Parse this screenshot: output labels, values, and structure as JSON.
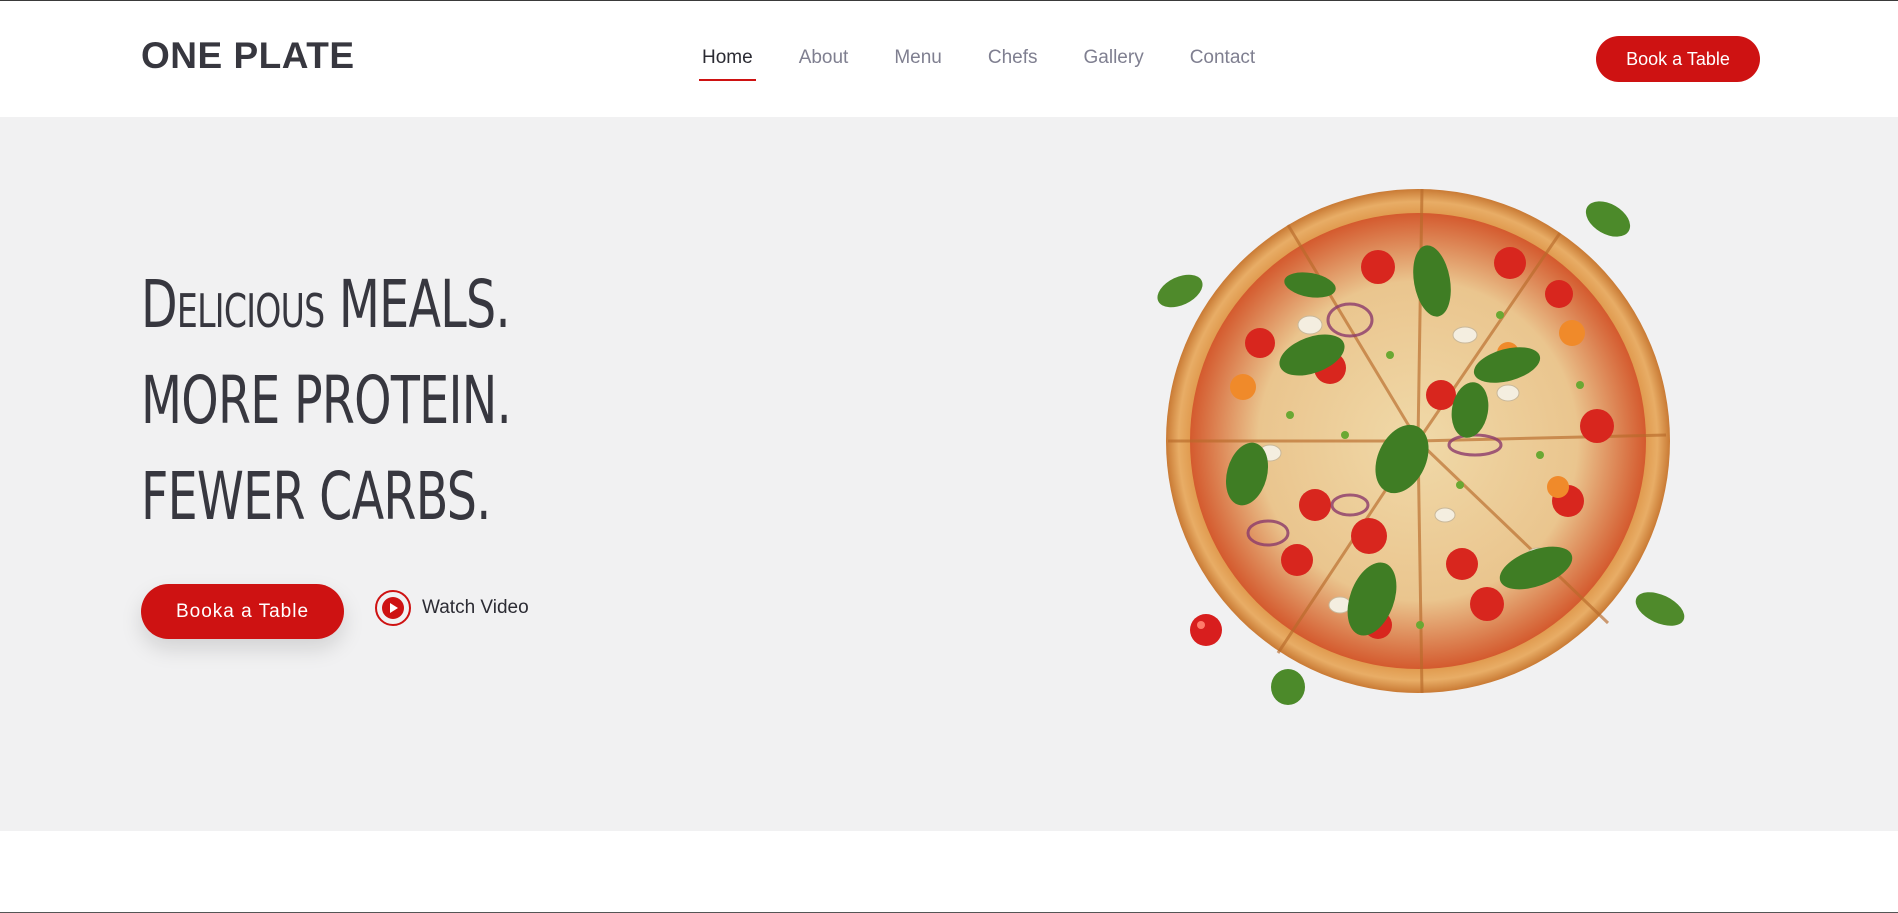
{
  "brand": {
    "name": "ONE PLATE"
  },
  "nav": {
    "items": [
      {
        "label": "Home",
        "active": true
      },
      {
        "label": "About",
        "active": false
      },
      {
        "label": "Menu",
        "active": false
      },
      {
        "label": "Chefs",
        "active": false
      },
      {
        "label": "Gallery",
        "active": false
      },
      {
        "label": "Contact",
        "active": false
      }
    ]
  },
  "header": {
    "cta_label": "Book a Table"
  },
  "hero": {
    "headline": [
      "Delicious MEALS.",
      "MORE PROTEIN.",
      "FEWER CARBS."
    ],
    "cta_label": "Booka a Table",
    "video_label": "Watch Video",
    "image_icon": "pizza-image"
  },
  "colors": {
    "accent": "#ce1212",
    "hero_bg": "#f1f1f2",
    "text": "#37373f",
    "nav_text": "#7f7f90"
  }
}
